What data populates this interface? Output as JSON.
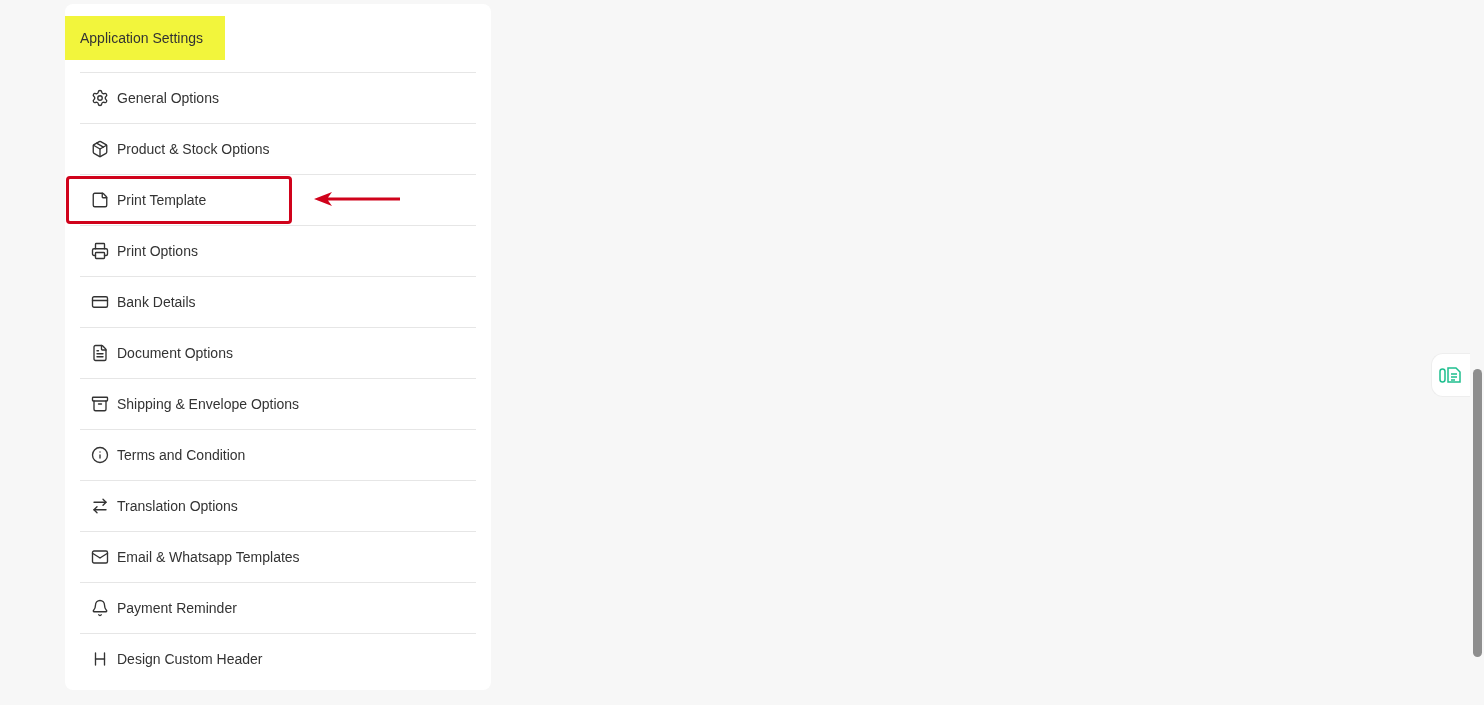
{
  "settings_panel": {
    "title": "Application Settings",
    "items": [
      {
        "label": "General Options",
        "highlighted": false
      },
      {
        "label": "Product & Stock Options",
        "highlighted": false
      },
      {
        "label": "Print Template",
        "highlighted": true
      },
      {
        "label": "Print Options",
        "highlighted": false
      },
      {
        "label": "Bank Details",
        "highlighted": false
      },
      {
        "label": "Document Options",
        "highlighted": false
      },
      {
        "label": "Shipping & Envelope Options",
        "highlighted": false
      },
      {
        "label": "Terms and Condition",
        "highlighted": false
      },
      {
        "label": "Translation Options",
        "highlighted": false
      },
      {
        "label": "Email & Whatsapp Templates",
        "highlighted": false
      },
      {
        "label": "Payment Reminder",
        "highlighted": false
      },
      {
        "label": "Design Custom Header",
        "highlighted": false
      }
    ]
  }
}
